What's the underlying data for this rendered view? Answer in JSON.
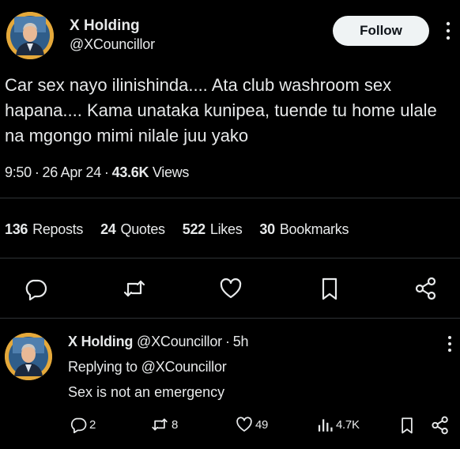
{
  "tweet": {
    "author_name": "X Holding",
    "author_handle": "@XCouncillor",
    "follow_label": "Follow",
    "text": "Car sex nayo ilinishinda.... Ata club washroom sex hapana.... Kama unataka kunipea, tuende tu home ulale na mgongo mimi nilale juu yako",
    "time": "9:50",
    "date": "26 Apr 24",
    "views_count": "43.6K",
    "views_label": "Views",
    "separator": "·",
    "stats": [
      {
        "count": "136",
        "label": "Reposts"
      },
      {
        "count": "24",
        "label": "Quotes"
      },
      {
        "count": "522",
        "label": "Likes"
      },
      {
        "count": "30",
        "label": "Bookmarks"
      }
    ],
    "actions": [
      "reply-icon",
      "repost-icon",
      "like-icon",
      "bookmark-icon",
      "share-icon"
    ]
  },
  "reply": {
    "author_name": "X Holding",
    "author_handle": "@XCouncillor",
    "age": "5h",
    "separator": "·",
    "replying_to": "Replying to @XCouncillor",
    "text": "Sex is not an emergency",
    "counts": {
      "replies": "2",
      "reposts": "8",
      "likes": "49",
      "views": "4.7K"
    }
  },
  "colors": {
    "background": "#000000",
    "text": "#e7e9ea",
    "divider": "#2f3336",
    "follow_button_bg": "#eff3f4",
    "avatar_ring": "#e5a93b"
  }
}
